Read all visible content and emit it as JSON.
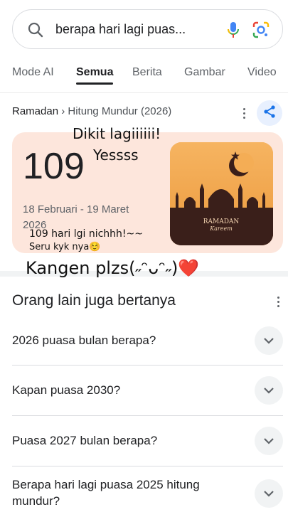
{
  "search": {
    "query": "berapa hari lagi puas..."
  },
  "tabs": [
    {
      "label": "Mode AI"
    },
    {
      "label": "Semua"
    },
    {
      "label": "Berita"
    },
    {
      "label": "Gambar"
    },
    {
      "label": "Video"
    }
  ],
  "result": {
    "breadcrumb_root": "Ramadan",
    "breadcrumb_sep": "›",
    "breadcrumb_leaf": "Hitung Mundur (2026)",
    "count": "109",
    "date_range": "18 Februari - 19 Maret 2026",
    "image_text_main": "RAMADAN",
    "image_text_script": "Kareem"
  },
  "annotations": {
    "line1": "Dikit lagiiiiii!",
    "line2": "Yessss",
    "line3": "109 hari lgi nichhh!~~",
    "line4": "Seru kyk nya☺️",
    "line5": "Kangen plzs(˶ᵔᴗᵔ˶)❤️"
  },
  "people_also_ask": {
    "title": "Orang lain juga bertanya",
    "questions": [
      "2026 puasa bulan berapa?",
      "Kapan puasa 2030?",
      "Puasa 2027 bulan berapa?",
      "Berapa hari lagi puasa 2025 hitung mundur?"
    ]
  },
  "colors": {
    "card_bg": "#fde6dc",
    "image_bg": "#f3a94e",
    "silhouette": "#3a1f1a",
    "accent_blue": "#1a73e8"
  }
}
